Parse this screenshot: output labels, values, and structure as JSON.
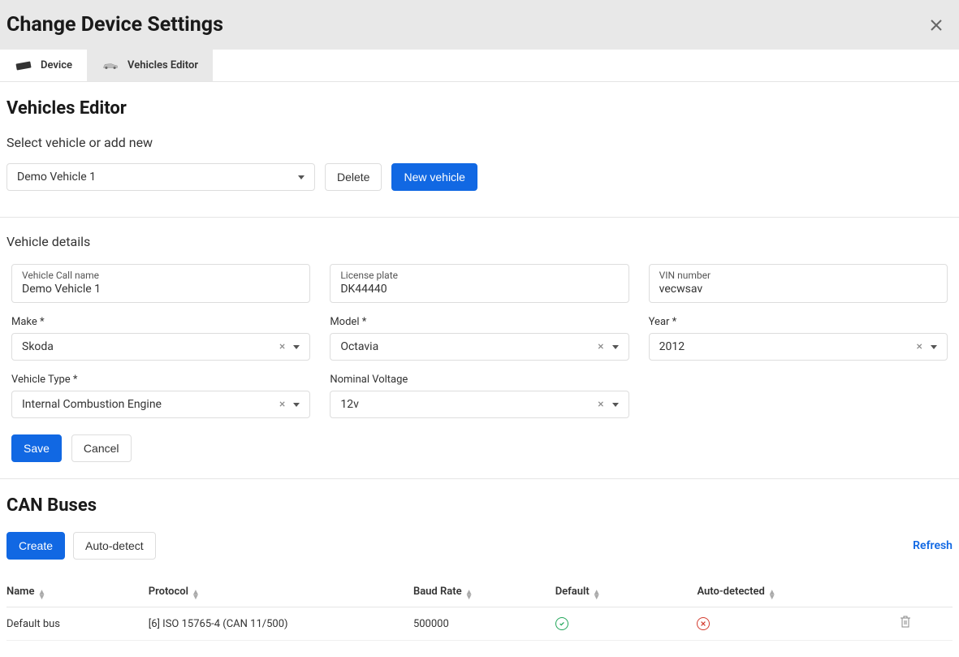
{
  "header": {
    "title": "Change Device Settings"
  },
  "tabs": [
    {
      "label": "Device",
      "active": false
    },
    {
      "label": "Vehicles Editor",
      "active": true
    }
  ],
  "editor": {
    "title": "Vehicles Editor",
    "select_label": "Select vehicle or add new",
    "selected_vehicle": "Demo Vehicle 1",
    "delete_label": "Delete",
    "new_vehicle_label": "New vehicle"
  },
  "details": {
    "title": "Vehicle details",
    "call_name": {
      "label": "Vehicle Call name",
      "value": "Demo Vehicle 1"
    },
    "license_plate": {
      "label": "License plate",
      "value": "DK44440"
    },
    "vin": {
      "label": "VIN number",
      "value": "vecwsav"
    },
    "make": {
      "label": "Make *",
      "value": "Skoda"
    },
    "model": {
      "label": "Model *",
      "value": "Octavia"
    },
    "year": {
      "label": "Year *",
      "value": "2012"
    },
    "vehicle_type": {
      "label": "Vehicle Type *",
      "value": "Internal Combustion Engine"
    },
    "nominal_voltage": {
      "label": "Nominal Voltage",
      "value": "12v"
    },
    "save_label": "Save",
    "cancel_label": "Cancel"
  },
  "canbus": {
    "title": "CAN Buses",
    "create_label": "Create",
    "autodetect_label": "Auto-detect",
    "refresh_label": "Refresh",
    "columns": {
      "name": "Name",
      "protocol": "Protocol",
      "baud_rate": "Baud Rate",
      "default": "Default",
      "autodetected": "Auto-detected"
    },
    "rows": [
      {
        "name": "Default bus",
        "protocol": "[6] ISO 15765-4 (CAN 11/500)",
        "baud_rate": "500000",
        "default": true,
        "autodetected": false
      }
    ]
  }
}
